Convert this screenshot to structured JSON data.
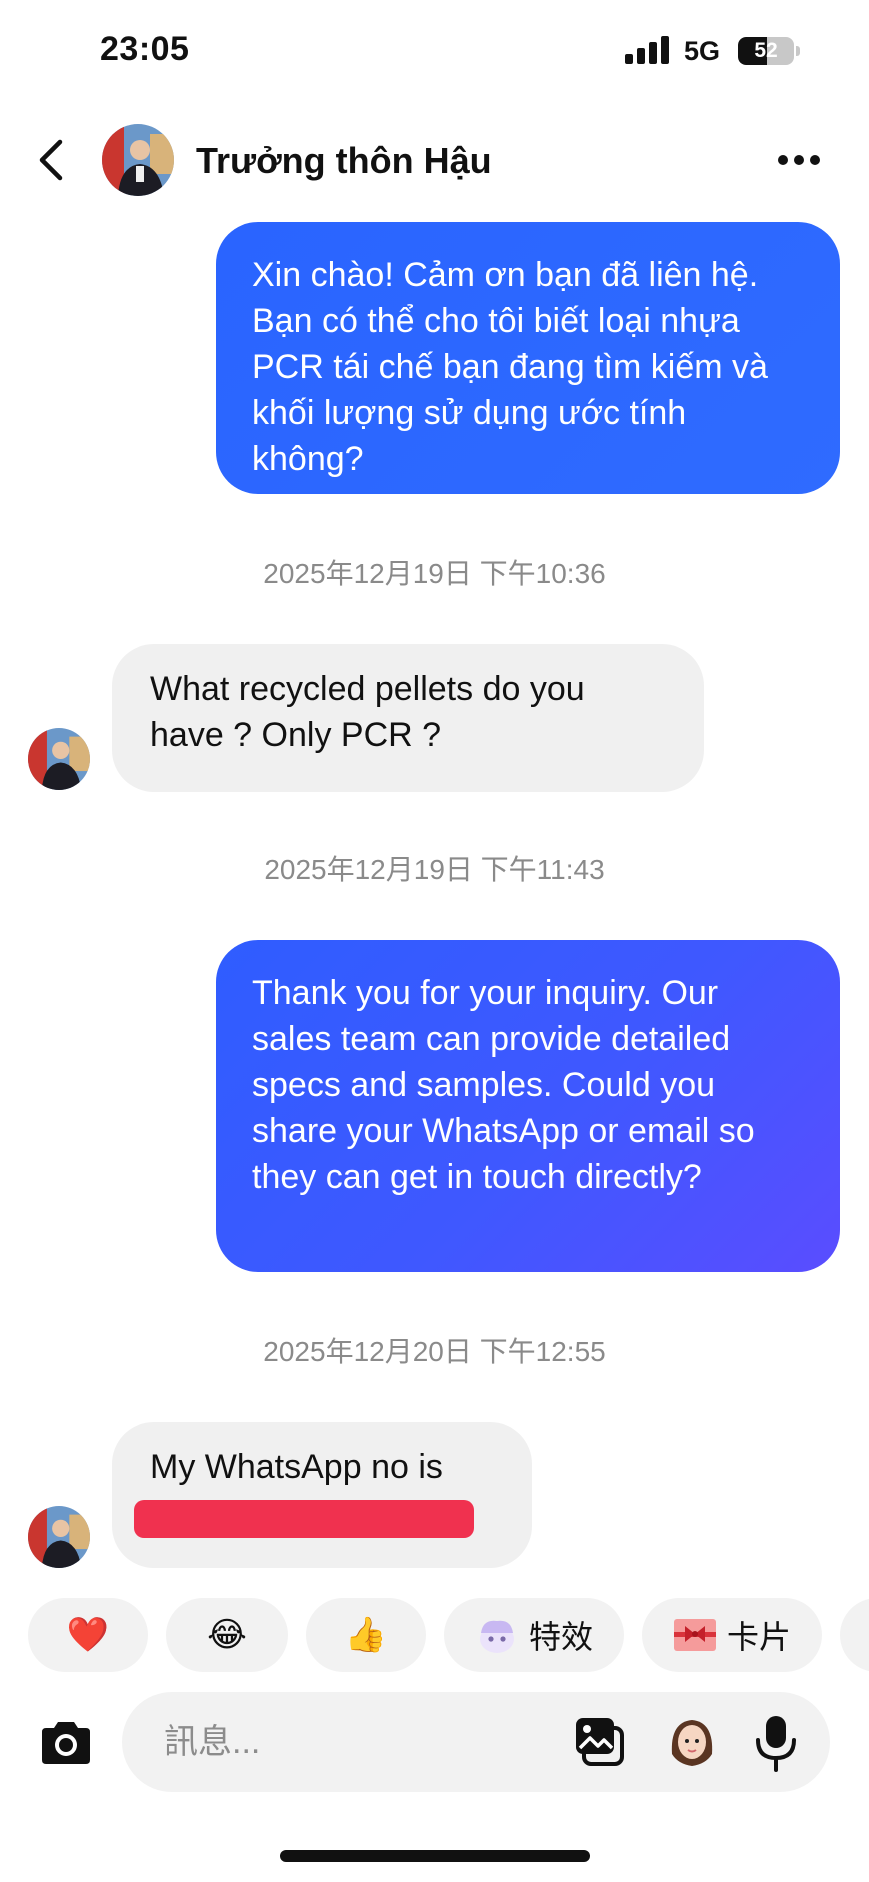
{
  "status_bar": {
    "time": "23:05",
    "network": "5G",
    "battery_level": "52",
    "battery_fraction": 0.52
  },
  "header": {
    "contact_name": "Trưởng thôn Hậu",
    "back_icon": "chevron-left-icon",
    "more_icon": "more-horizontal-icon"
  },
  "messages": [
    {
      "direction": "outgoing",
      "text": "Xin chào! Cảm ơn bạn đã liên hệ. Bạn có thể cho tôi biết loại nhựa PCR tái chế bạn đang tìm kiếm và khối lượng sử dụng ước tính không?"
    },
    {
      "timestamp": "2025年12月19日 下午10:36"
    },
    {
      "direction": "incoming",
      "text": "What recycled pellets do you have ? Only PCR ?"
    },
    {
      "timestamp": "2025年12月19日 下午11:43"
    },
    {
      "direction": "outgoing",
      "text": "Thank you for your inquiry. Our sales team can provide detailed specs and samples. Could you share your WhatsApp or email so they can get in touch directly?"
    },
    {
      "timestamp": "2025年12月20日 下午12:55"
    },
    {
      "direction": "incoming",
      "text": "My WhatsApp no is",
      "redacted": true
    }
  ],
  "quick_reactions": [
    {
      "icon": "❤️",
      "label": ""
    },
    {
      "icon": "😂",
      "label": ""
    },
    {
      "icon": "👍",
      "label": ""
    },
    {
      "icon": "effects-icon",
      "label": "特效"
    },
    {
      "icon": "card-icon",
      "label": "卡片"
    }
  ],
  "composer": {
    "placeholder": "訊息...",
    "value": ""
  },
  "colors": {
    "outgoing_gradient_start": "#2466ff",
    "outgoing_gradient_end": "#5a4dff",
    "incoming_bubble": "#f0f0f0",
    "redaction": "#f0314f"
  }
}
